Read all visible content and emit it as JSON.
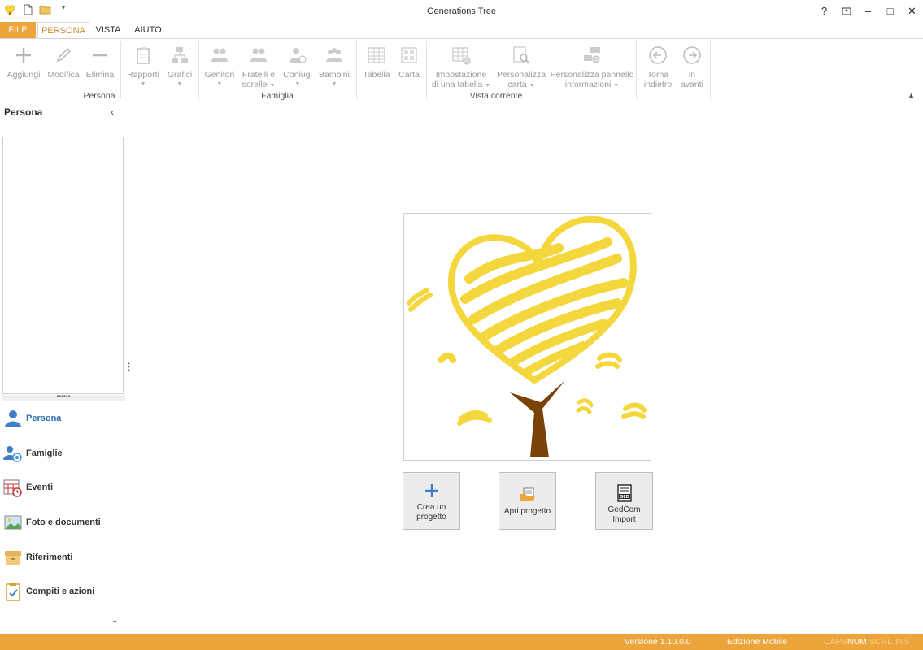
{
  "window": {
    "title": "Generations Tree"
  },
  "window_controls": {
    "help": "?",
    "restore_alt": "⧉",
    "minimize": "–",
    "maximize": "□",
    "close": "✕"
  },
  "tabs": {
    "file": "FILE",
    "persona": "PERSONA",
    "vista": "VISTA",
    "aiuto": "AIUTO"
  },
  "ribbon": {
    "persona_group": {
      "label": "Persona",
      "add": "Aggiungi",
      "edit": "Modifica",
      "delete": "Elimina"
    },
    "reports": "Rapporti",
    "charts": "Grafici",
    "famiglia_group": {
      "label": "Famiglia",
      "parents": "Genitori",
      "siblings_1": "Fratelli e",
      "siblings_2": "sorelle",
      "spouses": "Coniugi",
      "children": "Bambini"
    },
    "vista_group": {
      "label": "Vista corrente",
      "table": "Tabella",
      "map": "Carta",
      "table_setup_1": "Impostazione",
      "table_setup_2": "di una tabella",
      "customize_map_1": "Personalizza",
      "customize_map_2": "carta",
      "customize_panel_1": "Personalizza pannello",
      "customize_panel_2": "informazioni"
    },
    "back_1": "Torna",
    "back_2": "indietro",
    "forward_1": "in",
    "forward_2": "avanti"
  },
  "left_panel": {
    "title": "Persona",
    "nav": [
      {
        "label": "Persona",
        "icon": "person-icon"
      },
      {
        "label": "Famiglie",
        "icon": "families-icon"
      },
      {
        "label": "Eventi",
        "icon": "calendar-icon"
      },
      {
        "label": "Foto e documenti",
        "icon": "picture-icon"
      },
      {
        "label": "Riferimenti",
        "icon": "archive-icon"
      },
      {
        "label": "Compiti e azioni",
        "icon": "clipboard-icon"
      }
    ]
  },
  "start": {
    "create": {
      "label_1": "Crea un",
      "label_2": "progetto"
    },
    "open": {
      "label": "Apri progetto"
    },
    "gedcom": {
      "label": "GedCom Import"
    }
  },
  "status": {
    "version": "Versione 1.10.0.0",
    "edition": "Edizione Mobile",
    "caps": "CAPS",
    "num": "NUM",
    "scrl": "SCRL",
    "ins": "INS"
  },
  "colors": {
    "accent": "#eca43b",
    "logo_yellow": "#f4d73c",
    "trunk": "#7a4206",
    "active_nav": "#2d6fb3"
  }
}
